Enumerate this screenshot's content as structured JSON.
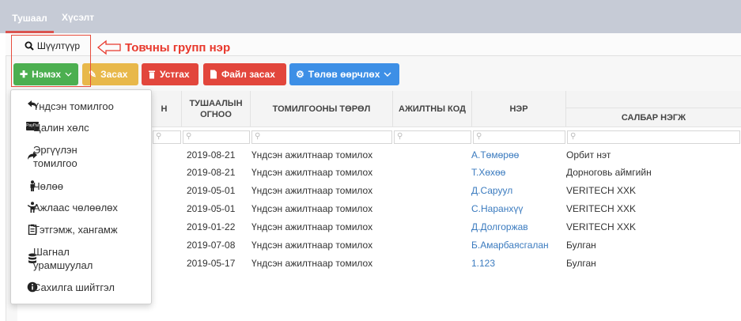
{
  "tabs": [
    {
      "label": "Тушаал"
    },
    {
      "label": "Хүсэлт"
    }
  ],
  "filter": {
    "label": "Шүүлтүүр"
  },
  "annotation": {
    "text": "Товчны групп нэр"
  },
  "toolbar": {
    "add": "Нэмэх",
    "edit": "Засах",
    "delete": "Устгах",
    "file_edit": "Файл засах",
    "status_change": "Төлөв өөрчлөх"
  },
  "table": {
    "headers": {
      "partial": "Н",
      "date": "ТУШААЛЫН ОГНОО",
      "type": "ТОМИЛГООНЫ ТӨРӨЛ",
      "code": "АЖИЛТНЫ КОД",
      "name": "НЭР",
      "unit": "САЛБАР НЭГЖ"
    },
    "rows": [
      {
        "date": "2019-08-21",
        "type": "Үндсэн ажилтнаар томилох",
        "name": "А.Төмөрөө",
        "unit": "Орбит нэт"
      },
      {
        "date": "2019-08-21",
        "type": "Үндсэн ажилтнаар томилох",
        "name": "Т.Хөхөө",
        "unit": "Дорноговь аймгийн"
      },
      {
        "date": "2019-05-01",
        "type": "Үндсэн ажилтнаар томилох",
        "name": "Д.Саруул",
        "unit": "VERITECH XXK"
      },
      {
        "date": "2019-05-01",
        "type": "Үндсэн ажилтнаар томилох",
        "name": "С.Наранхүү",
        "unit": "VERITECH XXK"
      },
      {
        "date": "2019-01-22",
        "type": "Үндсэн ажилтнаар томилох",
        "name": "Д.Долгоржав",
        "unit": "VERITECH XXK"
      },
      {
        "date": "2019-07-08",
        "type": "Үндсэн ажилтнаар томилох",
        "name": "Б.Амарбаясгалан",
        "unit": "Булган"
      },
      {
        "date": "2019-05-17",
        "type": "Үндсэн ажилтнаар томилох",
        "name": "1.123",
        "unit": "Булган"
      }
    ]
  },
  "menu": {
    "items": [
      {
        "label": "Үндсэн томилгоо",
        "icon": "reply-icon"
      },
      {
        "label": "Цалин хөлс",
        "icon": "paypal-icon",
        "badge": "PayPal"
      },
      {
        "label": "Эргүүлэн томилгоо",
        "label_line2": "томилгоо",
        "label_line1": "Эргүүлэн",
        "icon": "share-icon"
      },
      {
        "label": "Чөлөө",
        "icon": "person-icon"
      },
      {
        "label": "Ажлаас чөлөөлөх",
        "icon": "child-icon"
      },
      {
        "label": "Тэтгэмж, хангамж",
        "icon": "clipboard-icon"
      },
      {
        "label": "Шагнал урамшуулал",
        "label_line1": "Шагнал",
        "label_line2": "урамшуулал",
        "icon": "database-icon"
      },
      {
        "label": "Сахилга шийтгэл",
        "icon": "info-circle-icon"
      }
    ]
  },
  "colors": {
    "accent_red": "#d9534f",
    "green": "#4caf50",
    "yellow": "#e8b84a",
    "red": "#e2463c",
    "blue": "#3d8fe6",
    "link": "#3b7bbf"
  }
}
